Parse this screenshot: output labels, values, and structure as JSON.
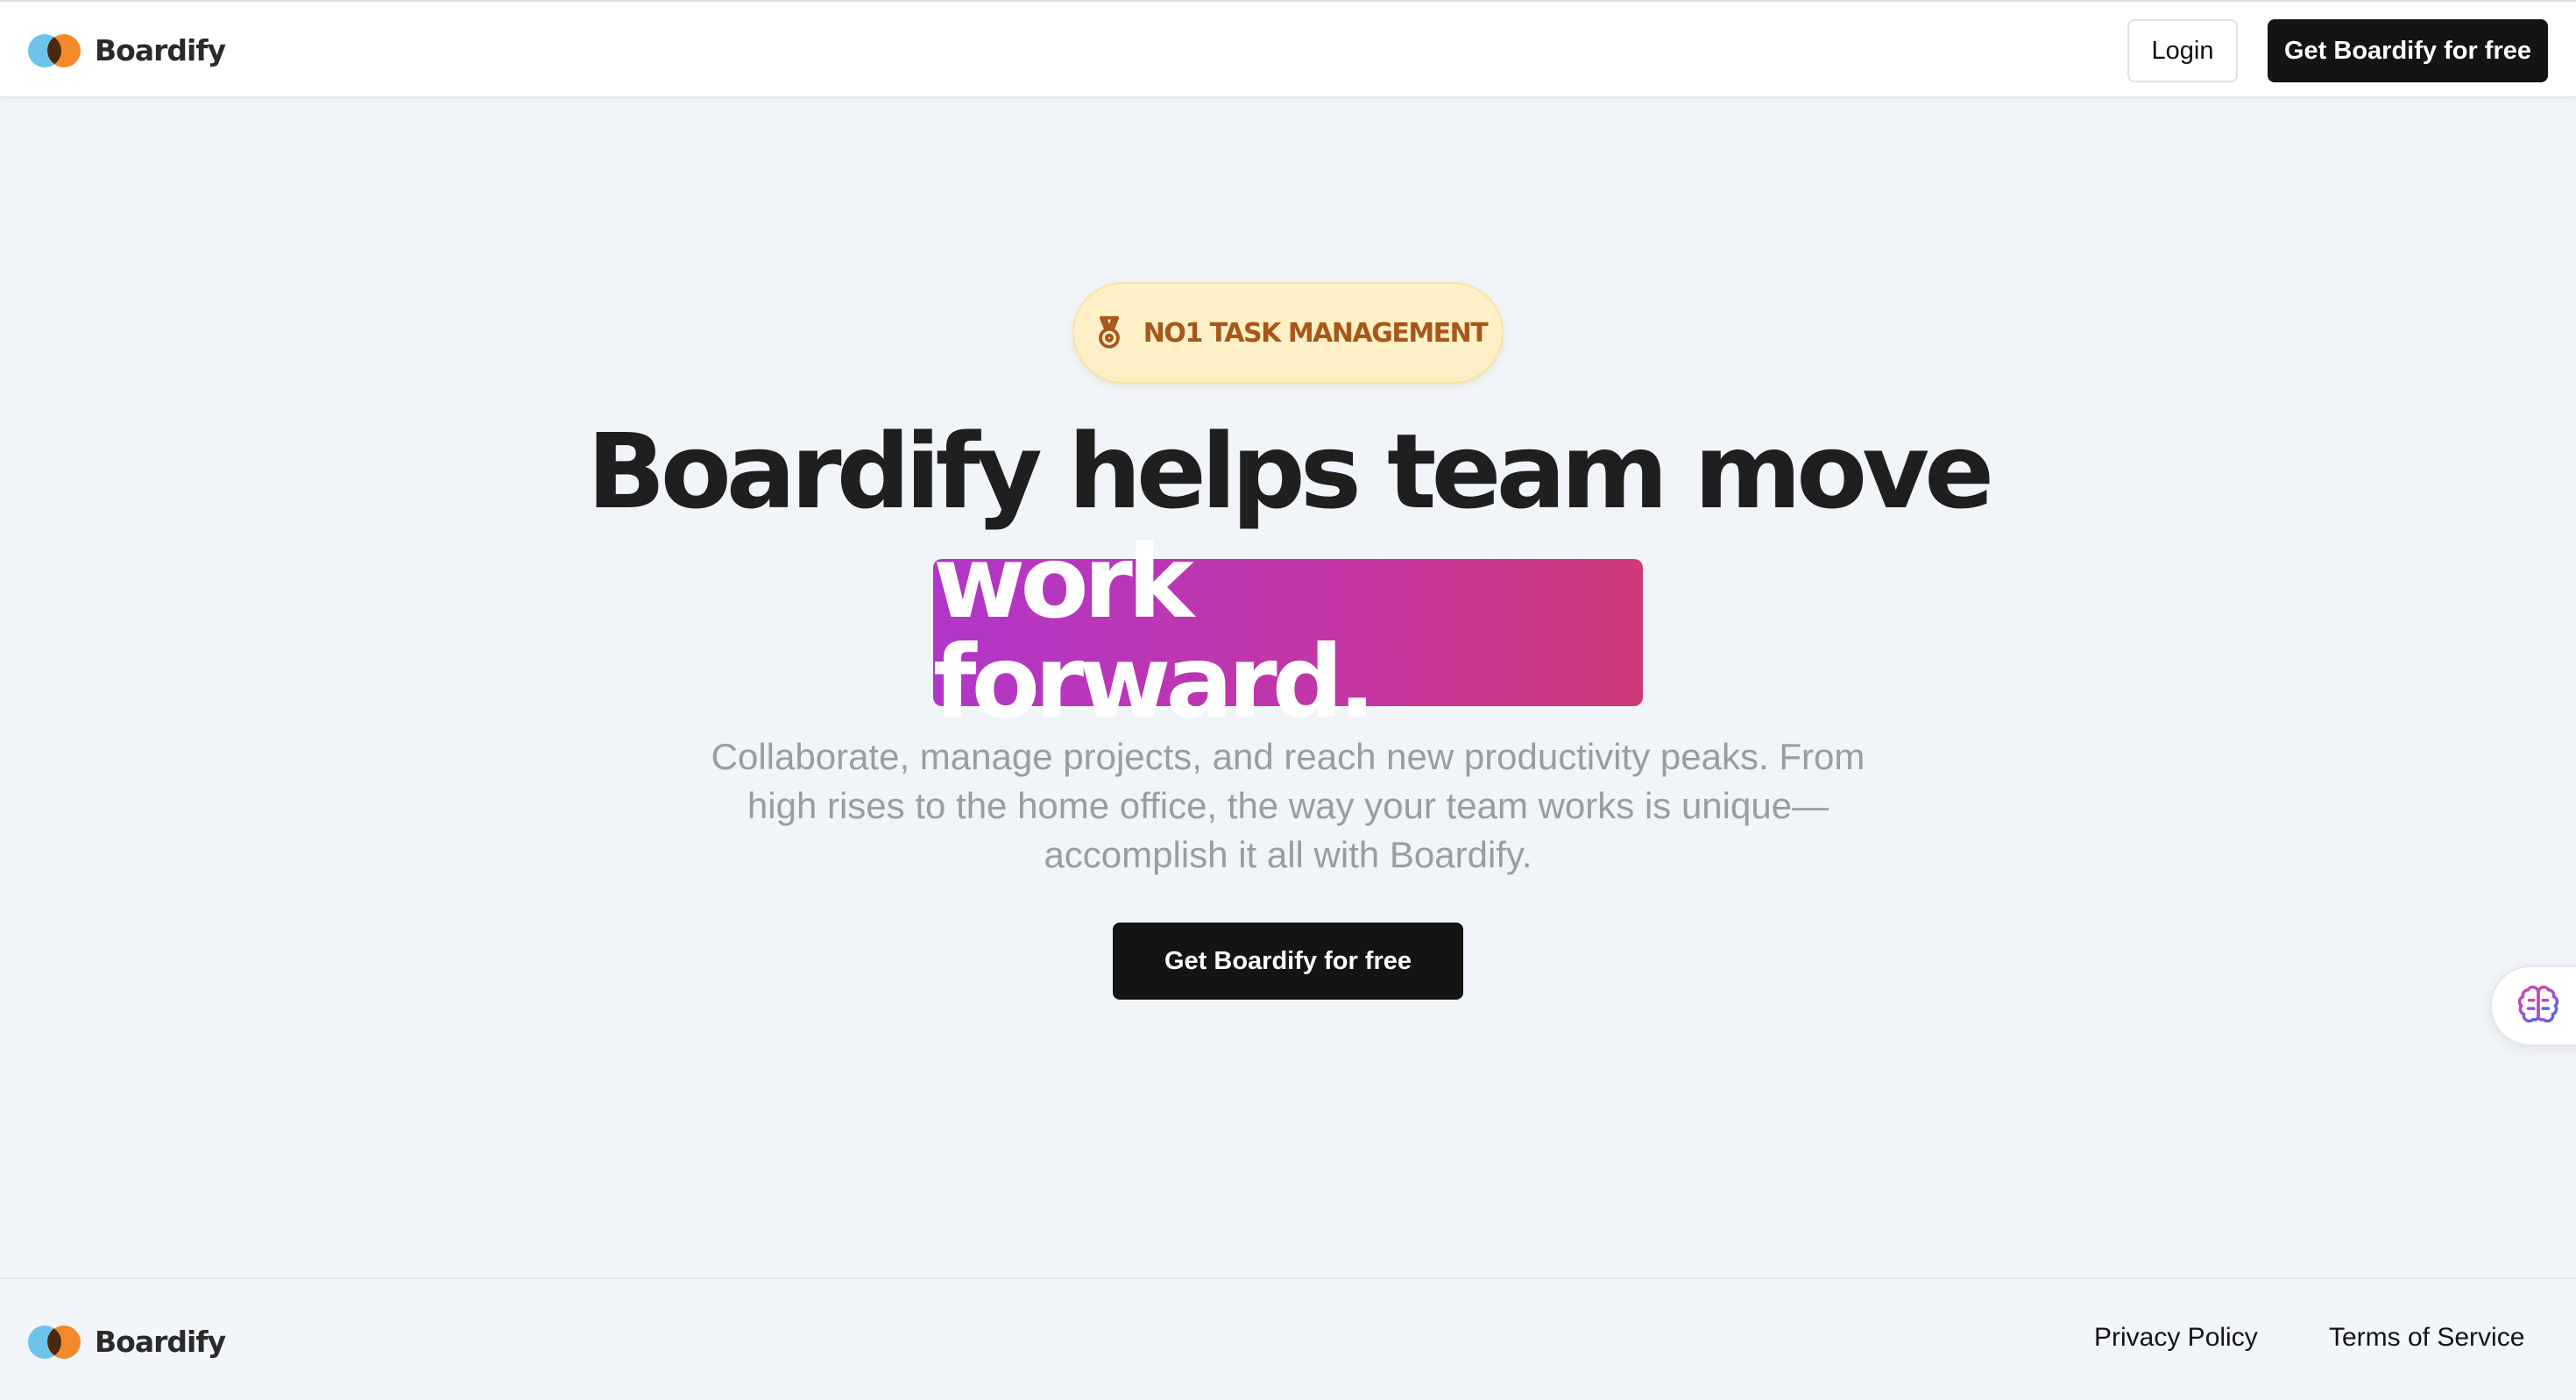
{
  "header": {
    "brand": "Boardify",
    "login_label": "Login",
    "cta_label": "Get Boardify for free"
  },
  "hero": {
    "badge": "NO1 TASK MANAGEMENT",
    "badge_icon": "medal-icon",
    "headline": "Boardify helps team move",
    "highlight": "work forward.",
    "subtitle": "Collaborate, manage projects, and reach new productivity peaks. From high rises to the home office, the way your team works is unique—accomplish it all with Boardify.",
    "cta_label": "Get Boardify for free"
  },
  "floating": {
    "icon": "brain-icon"
  },
  "footer": {
    "brand": "Boardify",
    "links": [
      {
        "label": "Privacy Policy"
      },
      {
        "label": "Terms of Service"
      }
    ]
  },
  "colors": {
    "background": "#f1f4f8",
    "primary_button": "#141414",
    "badge_bg": "#fdf0c6",
    "badge_text": "#a8561a",
    "gradient_start": "#b236c9",
    "gradient_end": "#cf3a78",
    "logo_blue": "#6ec3ea",
    "logo_orange": "#f28a2b"
  }
}
